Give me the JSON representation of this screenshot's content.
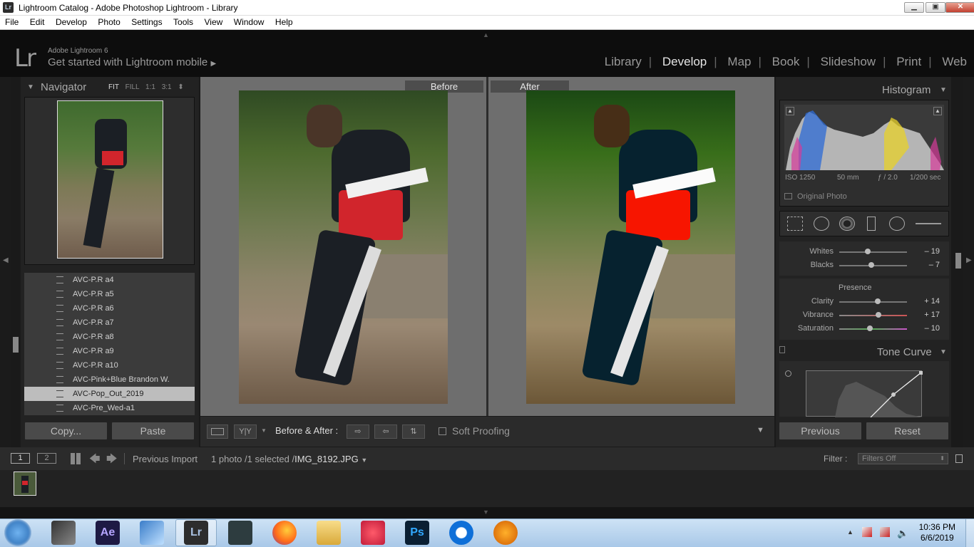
{
  "window": {
    "badge": "Lr",
    "title": "Lightroom Catalog - Adobe Photoshop Lightroom - Library"
  },
  "window_buttons": {
    "minimize": "▁",
    "maximize": "▣",
    "close": "✕"
  },
  "menu": [
    "File",
    "Edit",
    "Develop",
    "Photo",
    "Settings",
    "Tools",
    "View",
    "Window",
    "Help"
  ],
  "header": {
    "logo": "Lr",
    "version": "Adobe Lightroom 6",
    "get_started": "Get started with Lightroom mobile"
  },
  "modules": [
    "Library",
    "Develop",
    "Map",
    "Book",
    "Slideshow",
    "Print",
    "Web"
  ],
  "active_module": "Develop",
  "navigator": {
    "title": "Navigator",
    "opts": [
      "FIT",
      "FILL",
      "1:1",
      "3:1"
    ]
  },
  "presets": [
    "AVC-P.R a4",
    "AVC-P.R a5",
    "AVC-P.R a6",
    "AVC-P.R a7",
    "AVC-P.R a8",
    "AVC-P.R a9",
    "AVC-P.R a10",
    "AVC-Pink+Blue Brandon W.",
    "AVC-Pop_Out_2019",
    "AVC-Pre_Wed-a1"
  ],
  "selected_preset": "AVC-Pop_Out_2019",
  "left_buttons": {
    "copy": "Copy...",
    "paste": "Paste"
  },
  "center": {
    "before": "Before",
    "after": "After"
  },
  "toolbar": {
    "yy": "Y|Y",
    "before_after": "Before & After :",
    "soft_proofing": "Soft Proofing"
  },
  "histogram": {
    "title": "Histogram",
    "iso": "ISO 1250",
    "focal": "50 mm",
    "aperture": "ƒ / 2.0",
    "shutter": "1/200 sec",
    "original_photo": "Original Photo"
  },
  "basic": [
    {
      "label": "Whites",
      "value": "– 19",
      "pos": 0.42
    },
    {
      "label": "Blacks",
      "value": "– 7",
      "pos": 0.47
    }
  ],
  "presence": {
    "title": "Presence",
    "sliders": [
      {
        "label": "Clarity",
        "value": "+ 14",
        "pos": 0.57
      },
      {
        "label": "Vibrance",
        "value": "+ 17",
        "pos": 0.58
      },
      {
        "label": "Saturation",
        "value": "– 10",
        "pos": 0.45
      }
    ]
  },
  "tone_curve": {
    "title": "Tone Curve"
  },
  "right_buttons": {
    "previous": "Previous",
    "reset": "Reset"
  },
  "filmbar": {
    "view1": "1",
    "view2": "2",
    "source": "Previous Import",
    "count": "1 photo /1 selected /",
    "filename": "IMG_8192.JPG",
    "filter_label": "Filter :",
    "filter_value": "Filters Off"
  },
  "taskbar": {
    "time": "10:36 PM",
    "date": "6/6/2019",
    "apps": [
      "Windows",
      "Video",
      "After Effects",
      "App",
      "Lightroom",
      "Filmora",
      "Firefox",
      "Explorer",
      "Recorder",
      "Photoshop",
      "TeamViewer",
      "Audition"
    ]
  }
}
